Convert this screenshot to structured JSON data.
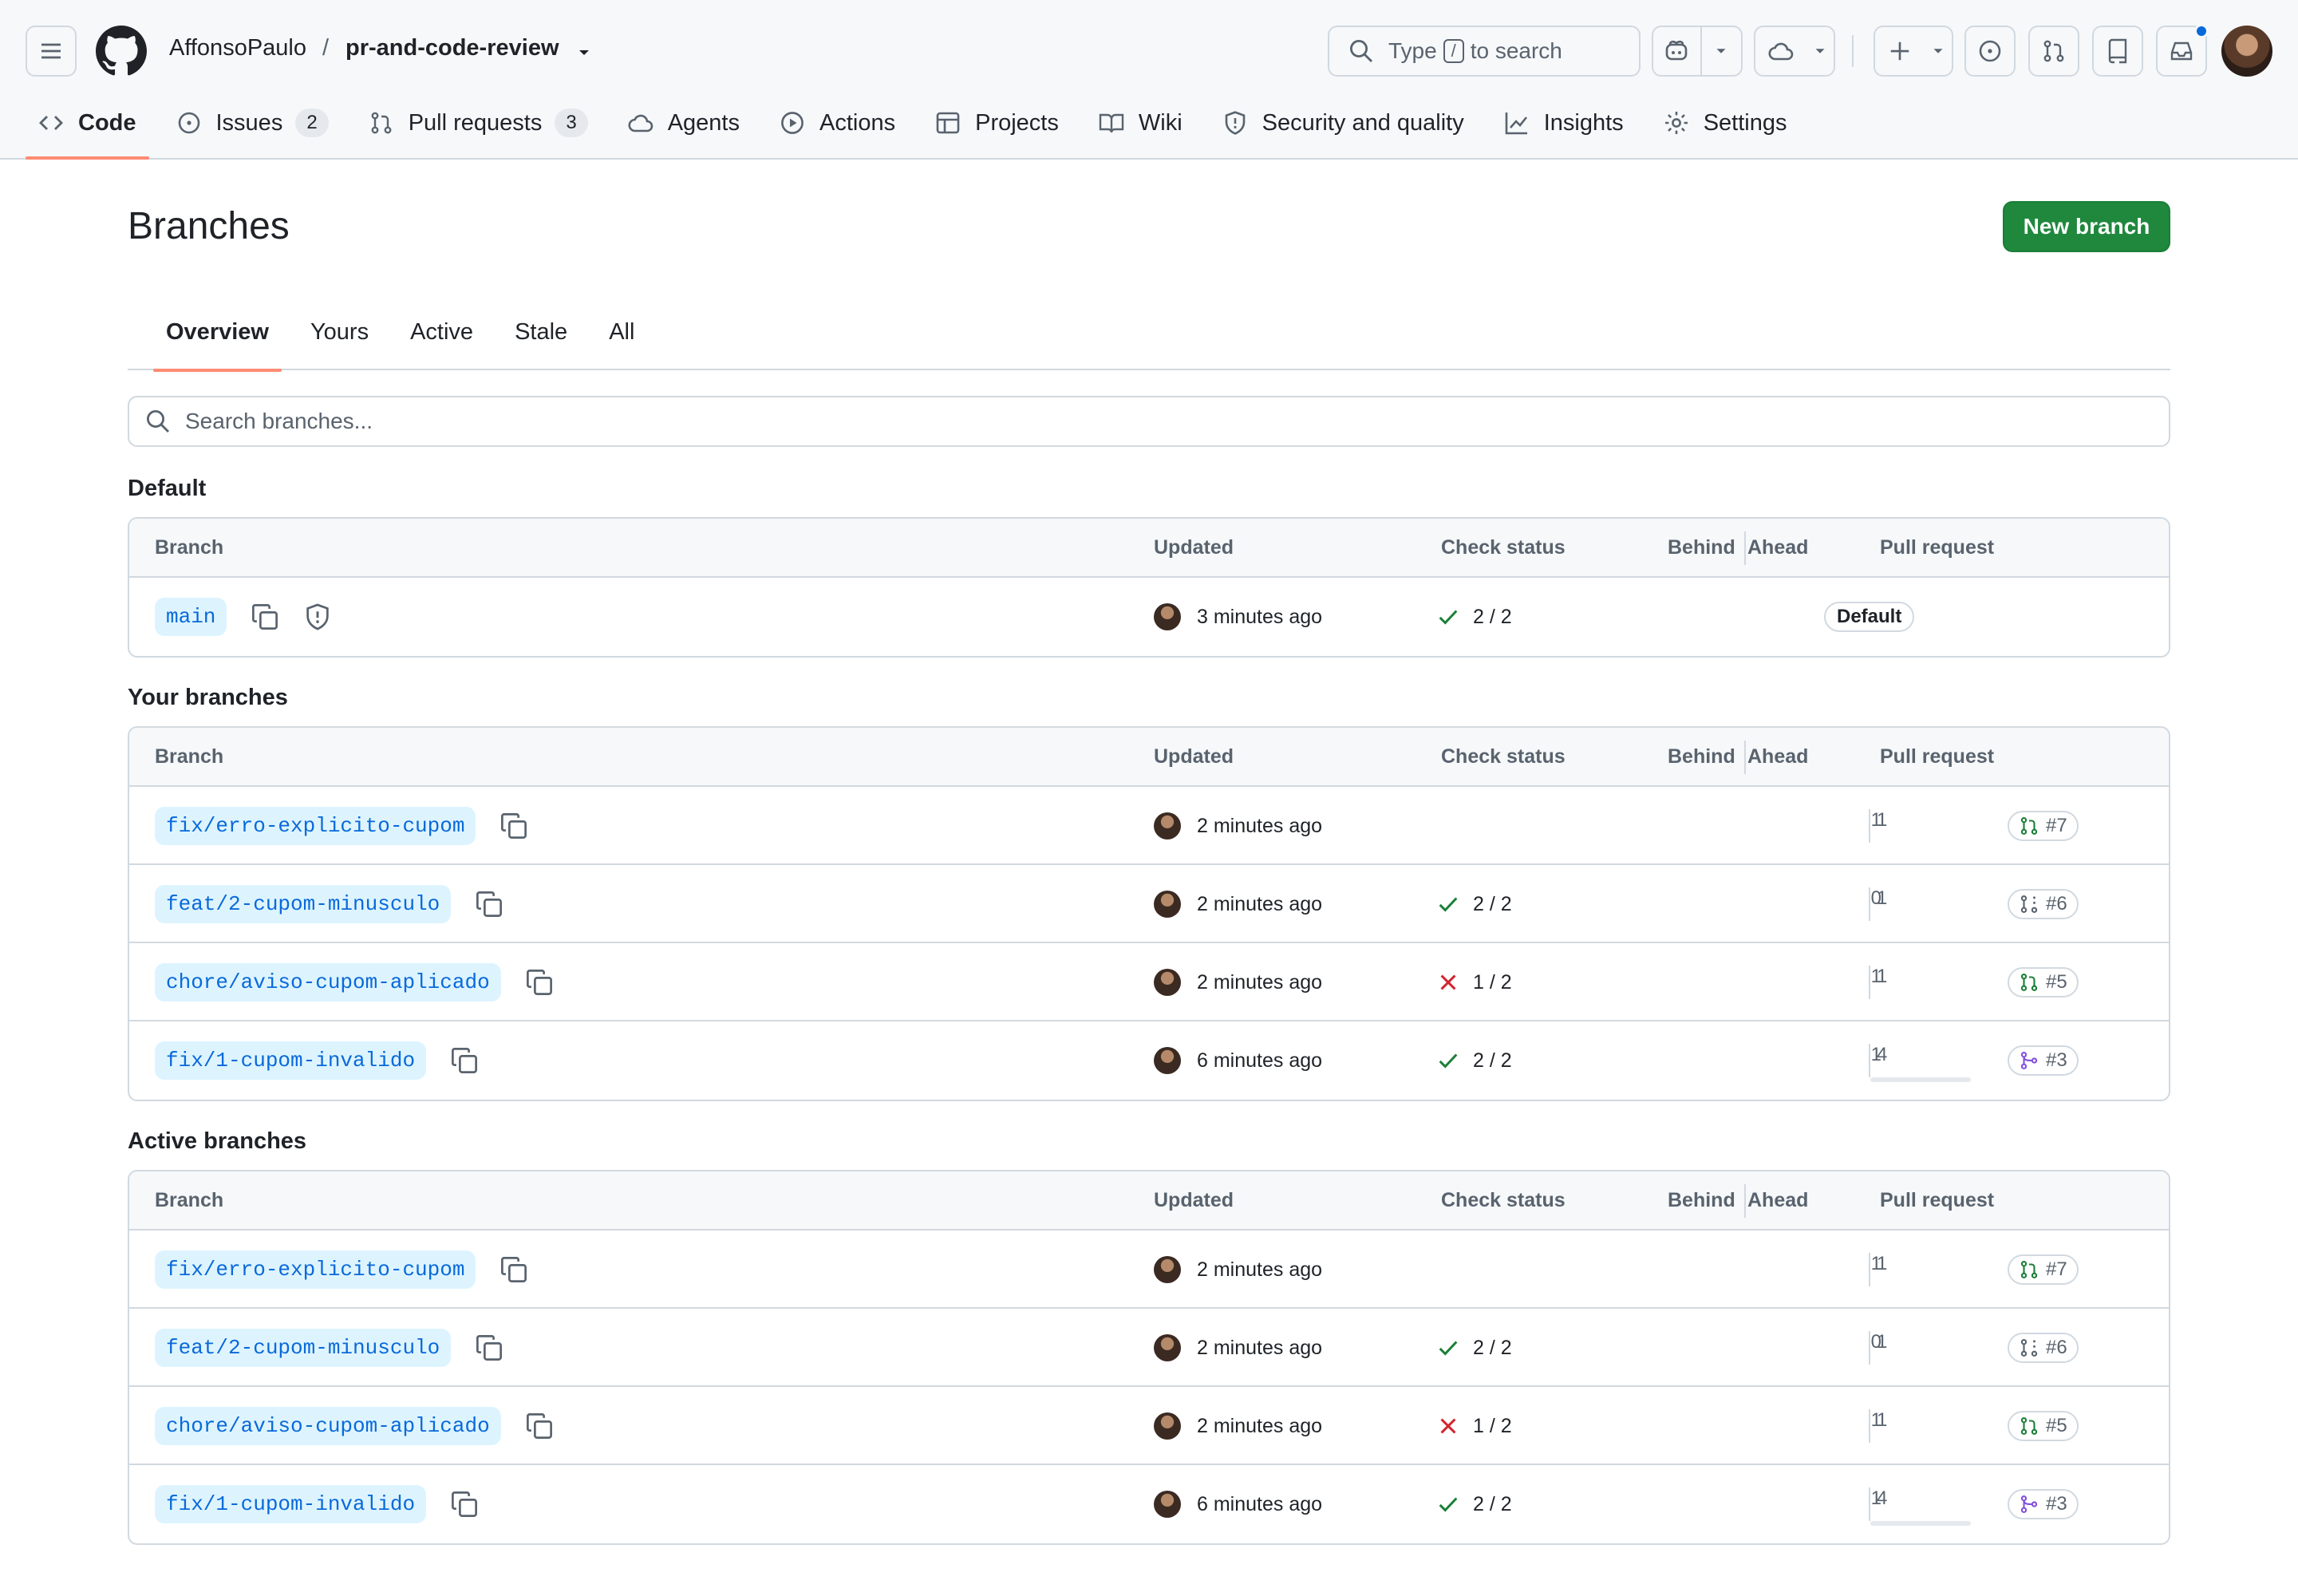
{
  "header": {
    "owner": "AffonsoPaulo",
    "separator": "/",
    "repo": "pr-and-code-review",
    "search_prefix": "Type",
    "search_key": "/",
    "search_suffix": "to search"
  },
  "nav": {
    "tabs": [
      {
        "label": "Code",
        "count": null,
        "icon": "code-icon"
      },
      {
        "label": "Issues",
        "count": "2",
        "icon": "issue-icon"
      },
      {
        "label": "Pull requests",
        "count": "3",
        "icon": "pull-request-icon"
      },
      {
        "label": "Agents",
        "count": null,
        "icon": "agent-icon"
      },
      {
        "label": "Actions",
        "count": null,
        "icon": "play-icon"
      },
      {
        "label": "Projects",
        "count": null,
        "icon": "table-icon"
      },
      {
        "label": "Wiki",
        "count": null,
        "icon": "book-icon"
      },
      {
        "label": "Security and quality",
        "count": null,
        "icon": "shield-icon"
      },
      {
        "label": "Insights",
        "count": null,
        "icon": "graph-icon"
      },
      {
        "label": "Settings",
        "count": null,
        "icon": "gear-icon"
      }
    ]
  },
  "page": {
    "title": "Branches",
    "new_branch": "New branch",
    "subtabs": [
      "Overview",
      "Yours",
      "Active",
      "Stale",
      "All"
    ],
    "search_placeholder": "Search branches..."
  },
  "columns": {
    "branch": "Branch",
    "updated": "Updated",
    "check": "Check status",
    "behind": "Behind",
    "ahead": "Ahead",
    "pr": "Pull request"
  },
  "sections": [
    {
      "title": "Default",
      "rows": [
        {
          "name": "main",
          "updated": "3 minutes ago",
          "check": "pass",
          "check_text": "2 / 2",
          "default_badge": "Default"
        }
      ]
    },
    {
      "title": "Your branches",
      "rows": [
        {
          "name": "fix/erro-explicito-cupom",
          "updated": "2 minutes ago",
          "check": "none",
          "check_text": "",
          "behind": "1",
          "ahead": "1",
          "pr": "#7",
          "pr_state": "open"
        },
        {
          "name": "feat/2-cupom-minusculo",
          "updated": "2 minutes ago",
          "check": "pass",
          "check_text": "2 / 2",
          "behind": "0",
          "ahead": "1",
          "pr": "#6",
          "pr_state": "draft"
        },
        {
          "name": "chore/aviso-cupom-aplicado",
          "updated": "2 minutes ago",
          "check": "fail",
          "check_text": "1 / 2",
          "behind": "1",
          "ahead": "1",
          "pr": "#5",
          "pr_state": "open"
        },
        {
          "name": "fix/1-cupom-invalido",
          "updated": "6 minutes ago",
          "check": "pass",
          "check_text": "2 / 2",
          "behind": "1",
          "ahead": "4",
          "pr": "#3",
          "pr_state": "merged"
        }
      ]
    },
    {
      "title": "Active branches",
      "rows": [
        {
          "name": "fix/erro-explicito-cupom",
          "updated": "2 minutes ago",
          "check": "none",
          "check_text": "",
          "behind": "1",
          "ahead": "1",
          "pr": "#7",
          "pr_state": "open"
        },
        {
          "name": "feat/2-cupom-minusculo",
          "updated": "2 minutes ago",
          "check": "pass",
          "check_text": "2 / 2",
          "behind": "0",
          "ahead": "1",
          "pr": "#6",
          "pr_state": "draft"
        },
        {
          "name": "chore/aviso-cupom-aplicado",
          "updated": "2 minutes ago",
          "check": "fail",
          "check_text": "1 / 2",
          "behind": "1",
          "ahead": "1",
          "pr": "#5",
          "pr_state": "open"
        },
        {
          "name": "fix/1-cupom-invalido",
          "updated": "6 minutes ago",
          "check": "pass",
          "check_text": "2 / 2",
          "behind": "1",
          "ahead": "4",
          "pr": "#3",
          "pr_state": "merged"
        }
      ]
    }
  ],
  "colors": {
    "accent": "#fd8c73",
    "primary_button": "#1f883d",
    "link": "#0969da",
    "pass": "#1a7f37",
    "fail": "#d1242f",
    "merged": "#8250df",
    "notification": "#0969da"
  }
}
